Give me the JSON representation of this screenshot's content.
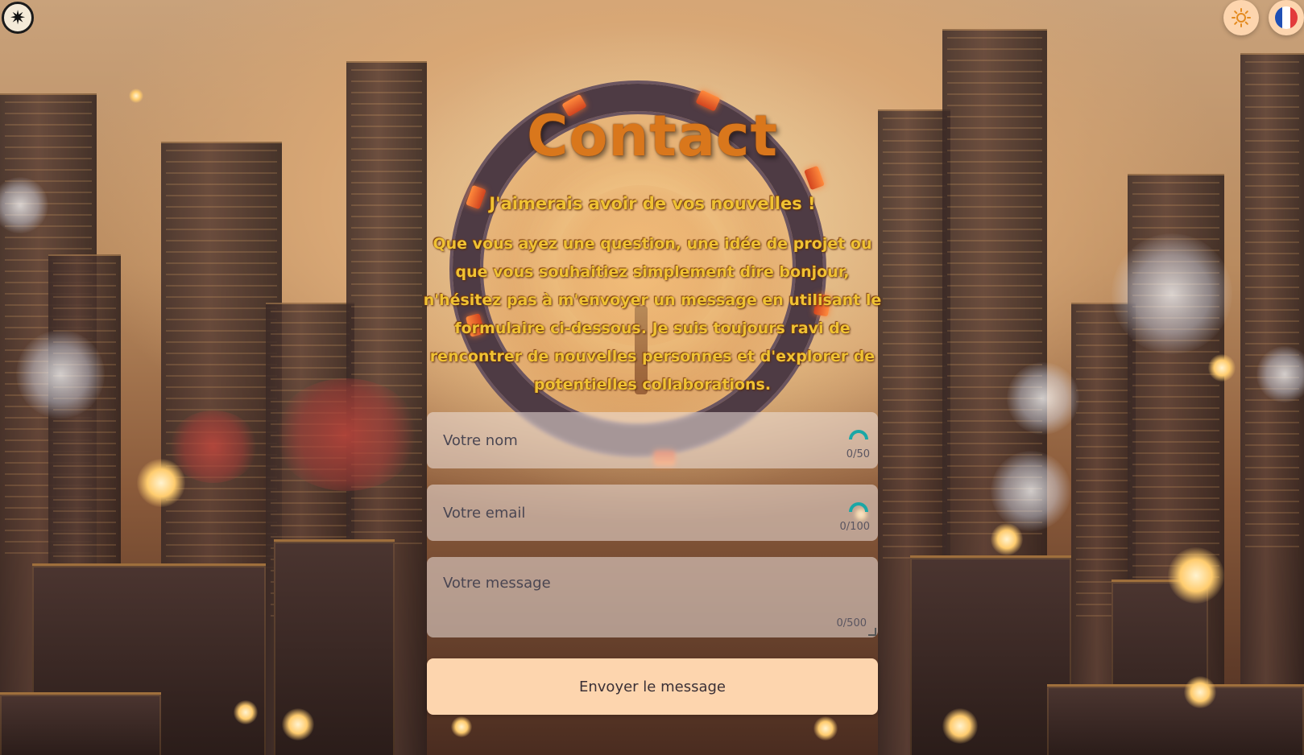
{
  "header": {
    "logo_icon": "compass-star-icon",
    "theme_toggle_icon": "sun-icon",
    "language_icon": "france-flag-icon"
  },
  "colors": {
    "title": "#d9771c",
    "intro_text": "#f0c233",
    "button_bg": "#fdd5ae",
    "spinner": "#1aa7a6"
  },
  "contact": {
    "title": "Contact",
    "subtitle": "J'aimerais avoir de vos nouvelles !",
    "intro_lines": [
      "Que vous ayez une question, une idée de projet ou",
      "que vous souhaitiez simplement dire bonjour,",
      "n'hésitez pas à m'envoyer un message en utilisant le",
      "formulaire ci-dessous. Je suis toujours ravi de",
      "rencontrer de nouvelles personnes et d'explorer de",
      "potentielles collaborations."
    ]
  },
  "form": {
    "name": {
      "placeholder": "Votre nom",
      "value": "",
      "counter": "0/50"
    },
    "email": {
      "placeholder": "Votre email",
      "value": "",
      "counter": "0/100"
    },
    "message": {
      "placeholder": "Votre message",
      "value": "",
      "counter": "0/500"
    },
    "submit_label": "Envoyer le message"
  }
}
